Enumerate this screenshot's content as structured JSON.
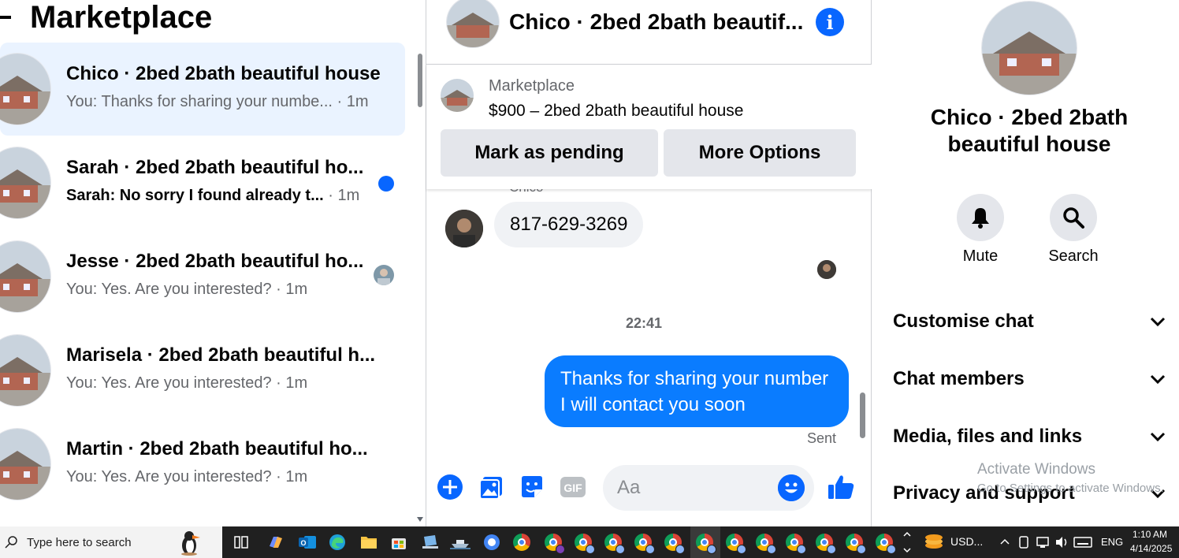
{
  "left_panel": {
    "title": "Marketplace",
    "conversations": [
      {
        "name": "Chico · 2bed 2bath beautiful house",
        "preview": "You: Thanks for sharing your numbe...",
        "time": " · 1m",
        "active": true
      },
      {
        "name": "Sarah · 2bed 2bath beautiful ho...",
        "preview": "Sarah: No sorry I found already t...",
        "time": " · 1m",
        "unread": true
      },
      {
        "name": "Jesse · 2bed 2bath beautiful ho...",
        "preview": "You: Yes. Are you interested? ",
        "time": "· 1m",
        "seen": true
      },
      {
        "name": "Marisela · 2bed 2bath beautiful h...",
        "preview": "You: Yes. Are you interested? ",
        "time": "· 1m"
      },
      {
        "name": "Martin · 2bed 2bath beautiful ho...",
        "preview": "You: Yes. Are you interested? ",
        "time": "· 1m"
      }
    ]
  },
  "chat": {
    "title": "Chico · 2bed 2bath beautif...",
    "listing_source": "Marketplace",
    "listing_title": "$900 – 2bed 2bath beautiful house",
    "mark_pending_label": "Mark as pending",
    "more_options_label": "More Options",
    "sender_name": "Chico",
    "incoming_message": "817-629-3269",
    "time_separator": "22:41",
    "outgoing_message": "Thanks for sharing your number I will contact you soon",
    "sent_status": "Sent",
    "composer_placeholder": "Aa"
  },
  "right_panel": {
    "title": "Chico · 2bed 2bath beautiful house",
    "mute_label": "Mute",
    "search_label": "Search",
    "sections": [
      "Customise chat",
      "Chat members",
      "Media, files and links",
      "Privacy and support"
    ]
  },
  "watermark": {
    "line1": "Activate Windows",
    "line2": "Go to Settings to activate Windows."
  },
  "taskbar": {
    "search_placeholder": "Type here to search",
    "currency_widget": "USD...",
    "language": "ENG",
    "time": "1:10 AM",
    "date": "4/14/2025"
  },
  "colors": {
    "accent": "#0866ff",
    "outgoing_bubble": "#0a7cff",
    "active_row": "#eaf3ff",
    "button_grey": "#e4e6eb"
  }
}
